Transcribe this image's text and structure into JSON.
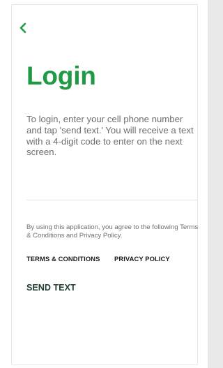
{
  "header": {
    "back_icon": "chevron-left-icon"
  },
  "page": {
    "title": "Login",
    "instructions": "To login, enter your cell phone number and tap 'send text.' You will receive a text with a 4-digit code to enter on the next screen."
  },
  "legal": {
    "agreement_text": "By using this application, you agree to the following Terms & Conditions and Privacy Policy.",
    "terms_label": "TERMS & CONDITIONS",
    "privacy_label": "PRIVACY POLICY"
  },
  "actions": {
    "send_label": "SEND TEXT"
  },
  "colors": {
    "accent": "#1f9a44",
    "text_muted": "#6f6f6f",
    "text_dark": "#1a1a1a",
    "send_dark_green": "#1e3b2b"
  }
}
